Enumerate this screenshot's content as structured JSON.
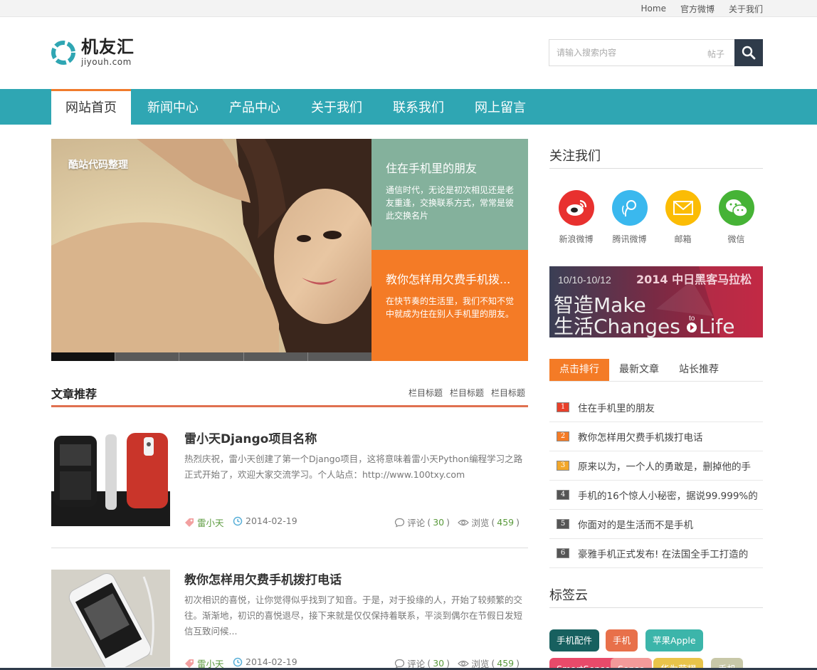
{
  "topbar": {
    "links": [
      "Home",
      "官方微博",
      "关于我们"
    ]
  },
  "logo": {
    "name": "机友汇",
    "domain": "jiyouh.com"
  },
  "search": {
    "placeholder": "请输入搜索内容",
    "scope": "帖子"
  },
  "nav": {
    "items": [
      "网站首页",
      "新闻中心",
      "产品中心",
      "关于我们",
      "联系我们",
      "网上留言"
    ],
    "active": 0
  },
  "slider": {
    "caption": "酷站代码整理",
    "slides": 5,
    "active": 0
  },
  "features": [
    {
      "title": "住在手机里的朋友",
      "desc": "通信时代，无论是初次相见还是老友重逢，交换联系方式，常常是彼此交换名片",
      "color": "#84b19c"
    },
    {
      "title": "教你怎样用欠费手机拨...",
      "desc": "在快节奏的生活里，我们不知不觉中就成为住在别人手机里的朋友。",
      "color": "#f47b26"
    }
  ],
  "recommend": {
    "title": "文章推荐",
    "columns": [
      "栏目标题",
      "栏目标题",
      "栏目标题"
    ],
    "articles": [
      {
        "title": "雷小天Django项目名称",
        "excerpt": "热烈庆祝，雷小天创建了第一个Django项目，这将意味着雷小天Python编程学习之路正式开始了，欢迎大家交流学习。个人站点：http://www.100txy.com",
        "author": "雷小天",
        "date": "2014-02-19",
        "comments_label": "评论",
        "comments": "30",
        "views_label": "浏览",
        "views": "459"
      },
      {
        "title": "教你怎样用欠费手机拨打电话",
        "excerpt": "初次相识的喜悦，让你觉得似乎找到了知音。于是，对于投缘的人，开始了较频繁的交往。渐渐地，初识的喜悦退尽，接下来就是仅仅保持着联系，平淡到偶尔在节假日发短信互致问候...",
        "author": "雷小天",
        "date": "2014-02-19",
        "comments_label": "评论",
        "comments": "30",
        "views_label": "浏览",
        "views": "459"
      }
    ]
  },
  "follow": {
    "title": "关注我们",
    "items": [
      {
        "label": "新浪微博",
        "icon": "weibo-icon",
        "color": "#e8312f"
      },
      {
        "label": "腾讯微博",
        "icon": "tencent-weibo-icon",
        "color": "#3ab8ee"
      },
      {
        "label": "邮箱",
        "icon": "mail-icon",
        "color": "#fbbc05"
      },
      {
        "label": "微信",
        "icon": "wechat-icon",
        "color": "#46b336"
      }
    ]
  },
  "banner": {
    "dates": "10/10-10/12",
    "headline": "2014 中日黑客马拉松",
    "line1": "智造Make",
    "line2": "生活Changes",
    "to": "to",
    "life": "Life"
  },
  "rank_tabs": {
    "items": [
      "点击排行",
      "最新文章",
      "站长推荐"
    ],
    "active": 0
  },
  "rank": [
    {
      "n": "1",
      "text": "住在手机里的朋友",
      "color": "#e8402a"
    },
    {
      "n": "2",
      "text": "教你怎样用欠费手机拨打电话",
      "color": "#f47b26"
    },
    {
      "n": "3",
      "text": "原来以为，一个人的勇敢是，删掉他的手",
      "color": "#f2a72a"
    },
    {
      "n": "4",
      "text": "手机的16个惊人小秘密，据说99.999%的",
      "color": "#555555"
    },
    {
      "n": "5",
      "text": "你面对的是生活而不是手机",
      "color": "#555555"
    },
    {
      "n": "6",
      "text": "豪雅手机正式发布! 在法国全手工打造的",
      "color": "#555555"
    }
  ],
  "tagcloud": {
    "title": "标签云",
    "tags": [
      {
        "label": "手机配件",
        "color": "#17605f"
      },
      {
        "label": "手机",
        "color": "#e8704a"
      },
      {
        "label": "苹果Apple",
        "color": "#3cb5aa"
      },
      {
        "label": "SmartSense",
        "color": "#e84a6a"
      },
      {
        "label": "Sense",
        "color": "#f39a9a"
      },
      {
        "label": "华为荣耀",
        "color": "#e8c44a"
      },
      {
        "label": "手机",
        "color": "#c8c8a8"
      }
    ]
  }
}
